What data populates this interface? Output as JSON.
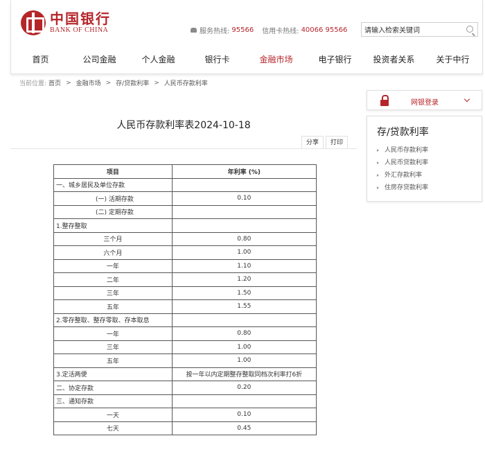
{
  "header": {
    "logo_cn": "中国银行",
    "logo_en": "BANK OF CHINA",
    "service_label": "服务热线:",
    "service_number": "95566",
    "card_label": "信用卡热线:",
    "card_number": "40066 95566",
    "search_value": "请输入检索关键词"
  },
  "nav": [
    "首页",
    "公司金融",
    "个人金融",
    "银行卡",
    "金融市场",
    "电子银行",
    "投资者关系",
    "关于中行"
  ],
  "breadcrumb": {
    "prefix": "当前位置:",
    "items": [
      "首页",
      "金融市场",
      "存/贷款利率",
      "人民币存款利率"
    ]
  },
  "page": {
    "title": "人民币存款利率表2024-10-18",
    "share": "分享",
    "print": "打印"
  },
  "table": {
    "headers": [
      "项目",
      "年利率 (%)"
    ],
    "rows": [
      [
        "一、城乡居民及单位存款",
        ""
      ],
      [
        "(一) 活期存款",
        "0.10"
      ],
      [
        "(二) 定期存款",
        ""
      ],
      [
        "1.整存整取",
        ""
      ],
      [
        "三个月",
        "0.80"
      ],
      [
        "六个月",
        "1.00"
      ],
      [
        "一年",
        "1.10"
      ],
      [
        "二年",
        "1.20"
      ],
      [
        "三年",
        "1.50"
      ],
      [
        "五年",
        "1.55"
      ],
      [
        "2.零存整取、整存零取、存本取息",
        ""
      ],
      [
        "一年",
        "0.80"
      ],
      [
        "三年",
        "1.00"
      ],
      [
        "五年",
        "1.00"
      ],
      [
        "3.定活两便",
        "按一年以内定期整存整取同档次利率打6折"
      ],
      [
        "二、协定存款",
        "0.20"
      ],
      [
        "三、通知存款",
        ""
      ],
      [
        "一天",
        "0.10"
      ],
      [
        "七天",
        "0.45"
      ]
    ]
  },
  "sidebar": {
    "login": "网银登录",
    "title": "存/贷款利率",
    "items": [
      "人民币存款利率",
      "人民币贷款利率",
      "外汇存款利率",
      "住房存贷款利率"
    ]
  },
  "colors": {
    "brand": "#b5262a",
    "border": "#555555"
  }
}
